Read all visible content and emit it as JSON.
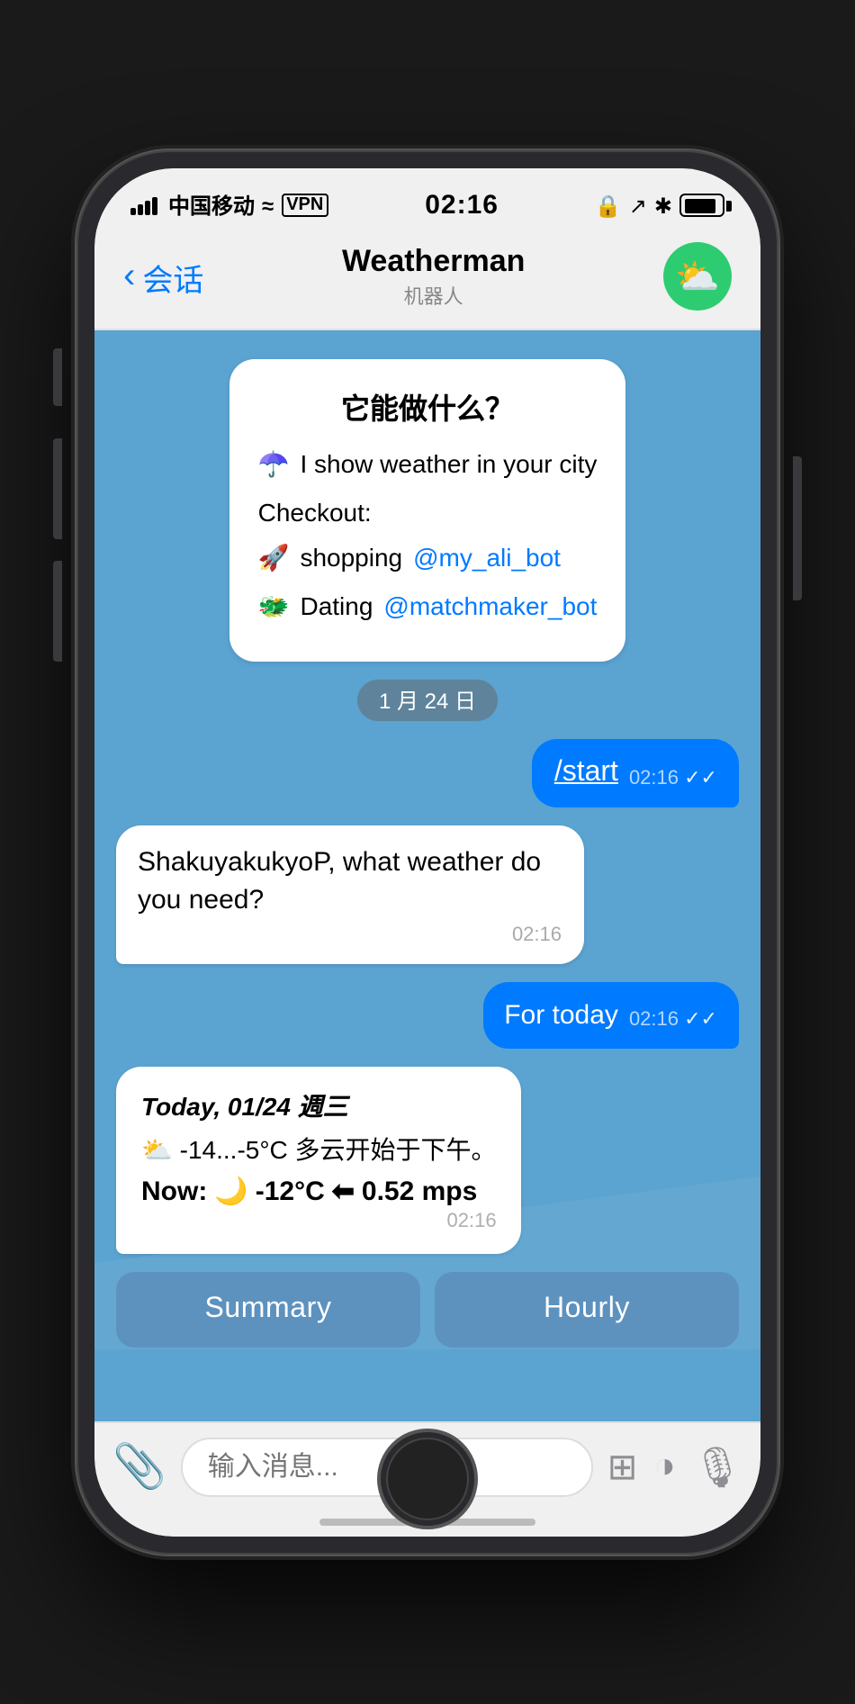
{
  "status": {
    "carrier": "中国移动",
    "wifi": "WiFi",
    "vpn": "VPN",
    "time": "02:16",
    "battery": "full"
  },
  "header": {
    "back_label": "会话",
    "title": "Weatherman",
    "subtitle": "机器人",
    "avatar_icon": "☁️"
  },
  "chat": {
    "welcome_bubble": {
      "title": "它能做什么？",
      "line1_emoji": "☂️",
      "line1_text": "I show weather in your city",
      "checkout_label": "Checkout:",
      "shopping_emoji": "🚀",
      "shopping_text": "shopping ",
      "shopping_link": "@my_ali_bot",
      "dating_emoji": "🐲",
      "dating_text": "Dating ",
      "dating_link": "@matchmaker_bot"
    },
    "date_divider": "1 月 24 日",
    "messages": [
      {
        "type": "outgoing",
        "text": "/start",
        "time": "02:16",
        "checks": "✓✓"
      },
      {
        "type": "incoming",
        "text": "ShakuyakukyoP, what weather do you need?",
        "time": "02:16"
      },
      {
        "type": "outgoing",
        "text": "For today",
        "time": "02:16",
        "checks": "✓✓"
      },
      {
        "type": "weather",
        "title": "Today, 01/24 週三",
        "line1_emoji": "⛅",
        "line1_text": "-14...-5°C 多云开始于下午。",
        "now_label": "Now:",
        "now_emoji": "🌙",
        "now_temp": "-12°C",
        "now_arrow": "⬅",
        "now_wind": "0.52 mps",
        "time": "02:16"
      }
    ],
    "inline_buttons": [
      {
        "label": "Summary"
      },
      {
        "label": "Hourly"
      }
    ]
  },
  "input": {
    "placeholder": "输入消息..."
  }
}
